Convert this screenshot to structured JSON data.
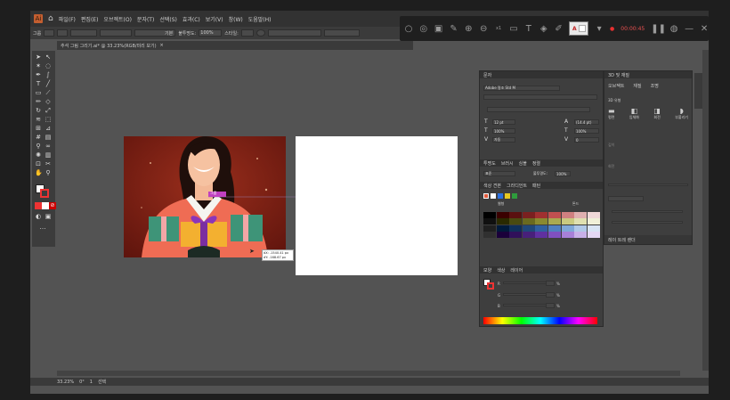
{
  "menu": {
    "app_logo": "Ai",
    "items": [
      "파일(F)",
      "편집(E)",
      "오브젝트(O)",
      "문자(T)",
      "선택(S)",
      "효과(C)",
      "보기(V)",
      "창(W)",
      "도움말(H)"
    ]
  },
  "options": {
    "group_label": "그룹",
    "stroke_style": "기본",
    "opacity_label": "불투명도:",
    "opacity_value": "100%",
    "style_label": "스타일:"
  },
  "capture_bar": {
    "timer": "00:00:45",
    "subscript": "x1",
    "swatch_letter": "A",
    "icons": [
      "circle-icon",
      "record-icon",
      "screen-icon",
      "pen-icon",
      "zoom-in-icon",
      "zoom-out-icon",
      "webcam-icon",
      "text-icon",
      "bucket-icon",
      "highlighter-icon"
    ]
  },
  "document_tab": {
    "title": "추석 그림 그리기.ai* @ 33.23%(RGB/미리 보기)",
    "close": "×"
  },
  "canvas": {
    "tooltip_label": "그룹",
    "tooltip_dx": "dX: -1540.41 px",
    "tooltip_dy": "dY: -168.67 px"
  },
  "char_panel": {
    "tabs": [
      "문자"
    ],
    "font_family": "Adobe 명조 Std M",
    "font_style": "",
    "size": "12 pt",
    "leading": "(14.4 pt)",
    "vscale": "100%",
    "hscale": "100%",
    "tracking": "자동",
    "kerning": "0",
    "sub_tabs": [
      "투명도",
      "브러시",
      "심볼",
      "정렬"
    ],
    "blend_mode": "표준",
    "blend_opacity_label": "불투명도:",
    "blend_opacity": "100%",
    "swatch_tabs": [
      "색상 견본",
      "그라디언트",
      "패턴"
    ],
    "swatch_col_left": "웹형",
    "swatch_col_right": "톤드",
    "sub_tabs2": [
      "색상",
      "속성",
      "레이어"
    ],
    "color_tabs": [
      "모양",
      "색상",
      "레이어"
    ],
    "color_channels": [
      "R",
      "G",
      "B"
    ],
    "percent": "%"
  },
  "threed_panel": {
    "title": "3D 및 재질",
    "tabs": [
      "오브젝트",
      "재질",
      "조명"
    ],
    "section": "3D 유형",
    "buttons": [
      "평면",
      "입체화",
      "회전",
      "부풀리기"
    ],
    "rows": [
      "깊이",
      "회전",
      "",
      "",
      "",
      "",
      ""
    ],
    "footer": "레이 트레 렌더"
  },
  "status": {
    "zoom": "33.23%",
    "angle": "0°",
    "page": "1",
    "tool": "선택"
  },
  "colors": {
    "accent": "#c35e30",
    "artboard_bg": "#7a1c12",
    "capture_bg": "#1f1f1f",
    "timer": "#e85050"
  }
}
